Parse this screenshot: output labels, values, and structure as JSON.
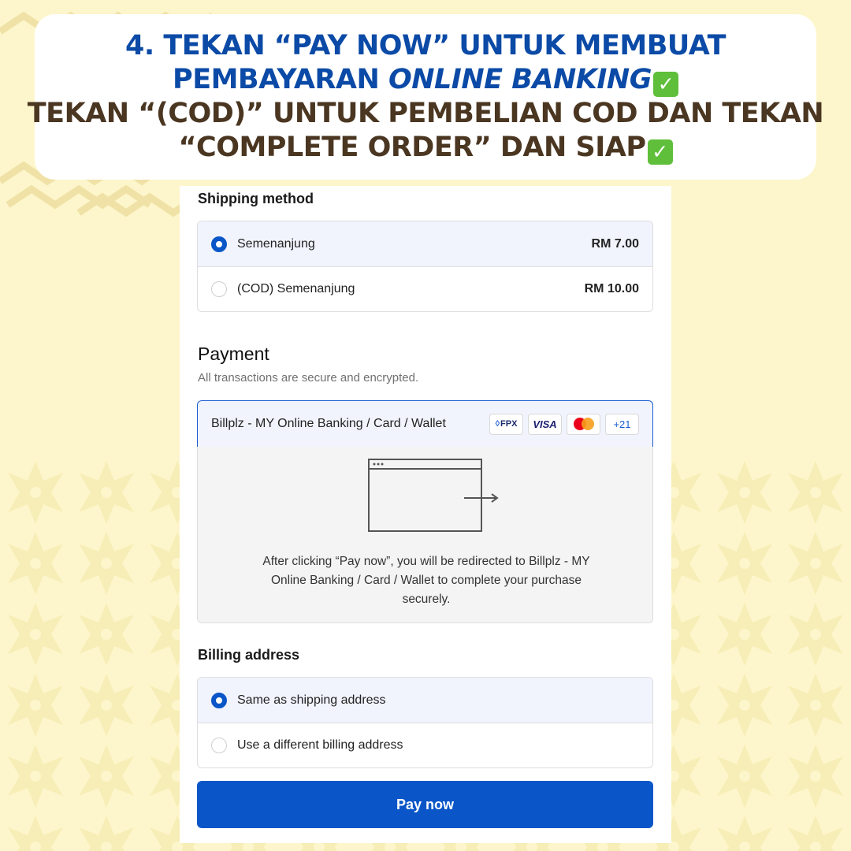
{
  "banner": {
    "line1": "4. TEKAN “PAY NOW” UNTUK MEMBUAT",
    "line2_prefix": "PEMBAYARAN ",
    "line2_italic": "ONLINE BANKING",
    "line3": "TEKAN “(COD)” UNTUK PEMBELIAN COD DAN TEKAN",
    "line4": "“COMPLETE ORDER” DAN SIAP",
    "check_icon": "check-mark-icon",
    "check_glyph": "✓"
  },
  "shipping": {
    "title": "Shipping method",
    "options": [
      {
        "label": "Semenanjung",
        "price": "RM 7.00",
        "selected": true
      },
      {
        "label": "(COD) Semenanjung",
        "price": "RM 10.00",
        "selected": false
      }
    ]
  },
  "payment": {
    "title": "Payment",
    "subtitle": "All transactions are secure and encrypted.",
    "method_label": "Billplz - MY Online Banking / Card / Wallet",
    "badges": {
      "fpx": "FPX",
      "visa": "VISA",
      "more": "+21"
    },
    "redirect_text": "After clicking “Pay now”, you will be redirected to Billplz - MY Online Banking / Card / Wallet to complete your purchase securely."
  },
  "billing": {
    "title": "Billing address",
    "options": [
      {
        "label": "Same as shipping address",
        "selected": true
      },
      {
        "label": "Use a different billing address",
        "selected": false
      }
    ]
  },
  "pay_button": "Pay now",
  "colors": {
    "accent": "#0a56c8",
    "banner_blue": "#0b4aa6",
    "banner_brown": "#4a3621",
    "background": "#fdf6cc"
  }
}
